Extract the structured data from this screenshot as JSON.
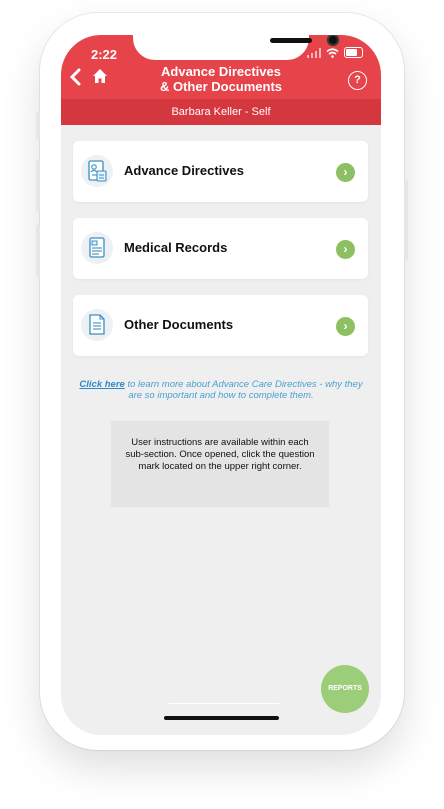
{
  "status_bar": {
    "time": "2:22"
  },
  "header": {
    "title_line1": "Advance Directives",
    "title_line2": "& Other Documents",
    "subtitle": "Barbara Keller - Self",
    "back_icon": "chevron-left-icon",
    "home_icon": "home-icon",
    "help_icon": "help-circle-icon",
    "help_symbol": "?",
    "accent_color": "#e6434b"
  },
  "cards": [
    {
      "label": "Advance Directives",
      "icon": "document-user-icon"
    },
    {
      "label": "Medical Records",
      "icon": "medical-record-icon"
    },
    {
      "label": "Other Documents",
      "icon": "documents-icon"
    }
  ],
  "card_arrow": "›",
  "info_text": {
    "link_label": "Click here",
    "rest": " to learn more about Advance Care Directives - why they are so important and how to complete them."
  },
  "instructions": "User instructions are available within each sub-section. Once opened, click the question mark located on the upper right corner.",
  "reports_button": "REPORTS"
}
